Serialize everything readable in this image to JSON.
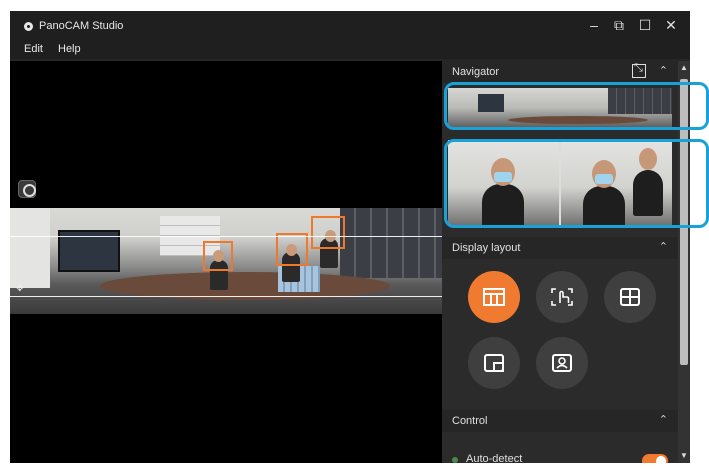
{
  "app": {
    "title": "PanoCAM Studio",
    "logo_icon": "camera-lens-icon"
  },
  "window_controls": {
    "minimize": "–",
    "restore": "⧉",
    "maximize": "☐",
    "close": "✕"
  },
  "menu": {
    "items": [
      "Edit",
      "Help"
    ]
  },
  "panel": {
    "navigator": {
      "title": "Navigator",
      "chevron": "⌃"
    },
    "display_layout": {
      "title": "Display layout",
      "chevron": "⌃",
      "buttons": [
        {
          "icon": "panorama-layout-icon",
          "active": true
        },
        {
          "icon": "touch-select-icon",
          "active": false
        },
        {
          "icon": "grid-4-icon",
          "active": false
        },
        {
          "icon": "picture-in-picture-icon",
          "active": false
        },
        {
          "icon": "speaker-focus-icon",
          "active": false
        }
      ]
    },
    "control": {
      "title": "Control",
      "chevron": "⌃",
      "auto_detect_label": "Auto-detect",
      "auto_detect_on": true
    }
  },
  "colors": {
    "accent": "#f07a30",
    "highlight": "#19a2d8",
    "panel_bg": "#2b2b2b"
  }
}
